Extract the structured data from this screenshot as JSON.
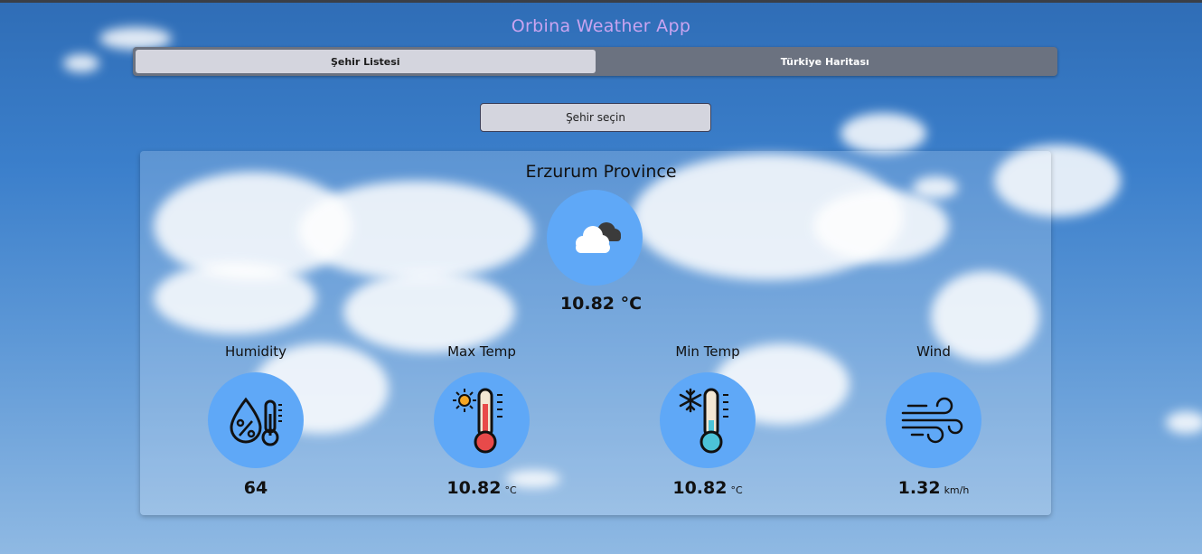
{
  "app": {
    "title": "Orbina Weather App"
  },
  "tabs": [
    {
      "label": "Şehir Listesi",
      "active": true
    },
    {
      "label": "Türkiye Haritası",
      "active": false
    }
  ],
  "city_select": {
    "placeholder": "Şehir seçin"
  },
  "weather": {
    "province": "Erzurum Province",
    "condition_icon": "cloudy-icon",
    "temperature": "10.82 °C",
    "stats": {
      "humidity": {
        "label": "Humidity",
        "value": "64",
        "unit": "",
        "icon": "humidity-icon"
      },
      "max_temp": {
        "label": "Max Temp",
        "value": "10.82",
        "unit": "°C",
        "icon": "hot-thermometer-icon"
      },
      "min_temp": {
        "label": "Min Temp",
        "value": "10.82",
        "unit": "°C",
        "icon": "cold-thermometer-icon"
      },
      "wind": {
        "label": "Wind",
        "value": "1.32",
        "unit": "km/h",
        "icon": "wind-icon"
      }
    }
  },
  "colors": {
    "accent_title": "#c9a4f0",
    "icon_circle": "#5fa8f7",
    "tab_bar": "#6b7280",
    "active_tab": "#d4d5de"
  }
}
